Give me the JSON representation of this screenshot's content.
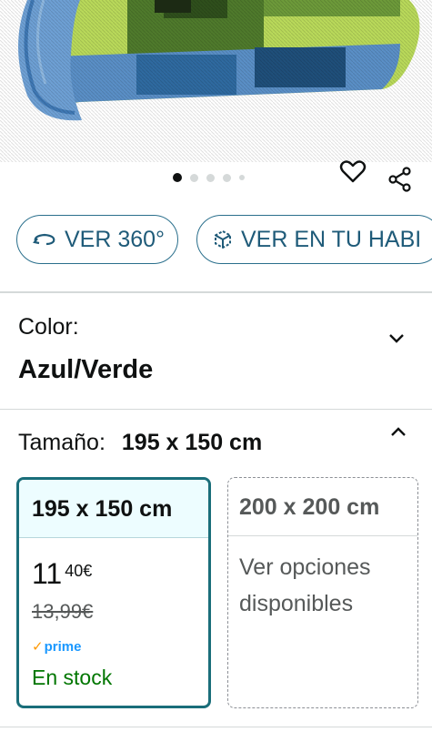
{
  "product_image": {
    "alt": "",
    "colors": {
      "green": "#b9d95a",
      "dark_green": "#355a22",
      "blue": "#5a8fc6",
      "navy": "#1f4f7a"
    }
  },
  "carousel": {
    "total": 5,
    "active": 0
  },
  "actions": {
    "wishlist_icon": "heart-outline-icon",
    "share_icon": "share-icon"
  },
  "buttons": {
    "view360_label": "VER 360°",
    "view_room_label": "VER EN TU HABI"
  },
  "color": {
    "label": "Color:",
    "value": "Azul/Verde"
  },
  "size": {
    "label": "Tamaño:",
    "value": "195 x 150 cm",
    "options": [
      {
        "label": "195 x 150 cm",
        "price_whole": "11",
        "price_fraction": "40€",
        "old_price": "13,99€",
        "prime": "prime",
        "stock": "En stock"
      },
      {
        "label": "200 x 200 cm",
        "note": "Ver opciones disponibles"
      }
    ]
  },
  "theme": {
    "accent": "#1a6e7a",
    "link": "#1f5b79",
    "stock_green": "#007600",
    "prime_blue": "#1a98ff"
  }
}
